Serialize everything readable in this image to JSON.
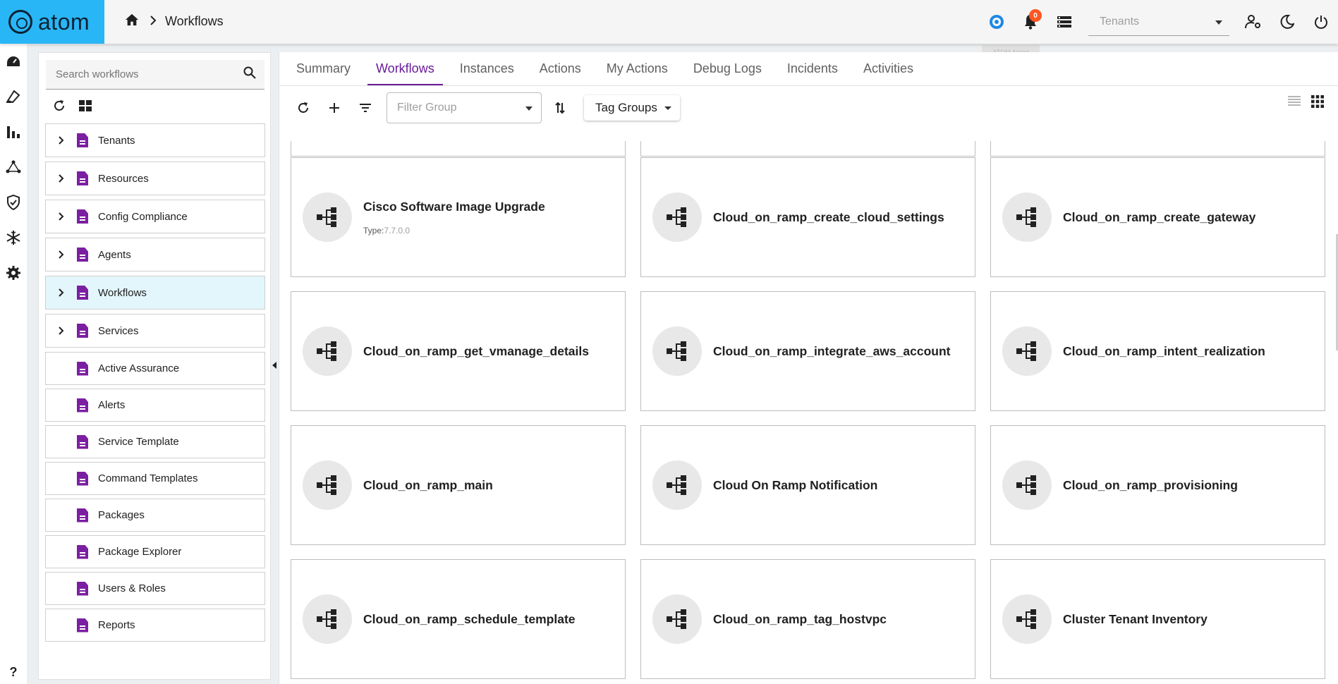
{
  "app": {
    "logo_text": "atom"
  },
  "header": {
    "breadcrumb_current": "Workflows",
    "notification_count": "0",
    "tenant_placeholder": "Tenants",
    "tooltip": "ATOM Assist"
  },
  "rail": {
    "items": [
      "dashboard-icon",
      "devices-icon",
      "analytics-icon",
      "topology-icon",
      "security-icon",
      "snowflake-icon",
      "settings-icon"
    ],
    "help": "?"
  },
  "sidebar": {
    "search_placeholder": "Search workflows",
    "items": [
      {
        "label": "Tenants",
        "expandable": true
      },
      {
        "label": "Resources",
        "expandable": true
      },
      {
        "label": "Config Compliance",
        "expandable": true
      },
      {
        "label": "Agents",
        "expandable": true
      },
      {
        "label": "Workflows",
        "expandable": true,
        "active": true
      },
      {
        "label": "Services",
        "expandable": true
      },
      {
        "label": "Active Assurance",
        "expandable": false
      },
      {
        "label": "Alerts",
        "expandable": false
      },
      {
        "label": "Service Template",
        "expandable": false
      },
      {
        "label": "Command Templates",
        "expandable": false
      },
      {
        "label": "Packages",
        "expandable": false
      },
      {
        "label": "Package Explorer",
        "expandable": false
      },
      {
        "label": "Users & Roles",
        "expandable": false
      },
      {
        "label": "Reports",
        "expandable": false
      }
    ]
  },
  "tabs": [
    "Summary",
    "Workflows",
    "Instances",
    "Actions",
    "My Actions",
    "Debug Logs",
    "Incidents",
    "Activities"
  ],
  "active_tab": "Workflows",
  "toolbar": {
    "filter_group_placeholder": "Filter Group",
    "tag_groups_label": "Tag Groups"
  },
  "cards": [
    {
      "title": "Cisco Software Image Upgrade",
      "type_label": "Type:",
      "type_value": "7.7.0.0"
    },
    {
      "title": "Cloud_on_ramp_create_cloud_settings"
    },
    {
      "title": "Cloud_on_ramp_create_gateway"
    },
    {
      "title": "Cloud_on_ramp_get_vmanage_details"
    },
    {
      "title": "Cloud_on_ramp_integrate_aws_account"
    },
    {
      "title": "Cloud_on_ramp_intent_realization"
    },
    {
      "title": "Cloud_on_ramp_main"
    },
    {
      "title": "Cloud On Ramp Notification"
    },
    {
      "title": "Cloud_on_ramp_provisioning"
    },
    {
      "title": "Cloud_on_ramp_schedule_template"
    },
    {
      "title": "Cloud_on_ramp_tag_hostvpc"
    },
    {
      "title": "Cluster Tenant Inventory"
    }
  ],
  "colors": {
    "accent": "#6a1b9a",
    "logo_bg": "#29b6f6",
    "doc_icon": "#7b1fa2",
    "badge": "#ff5722"
  }
}
